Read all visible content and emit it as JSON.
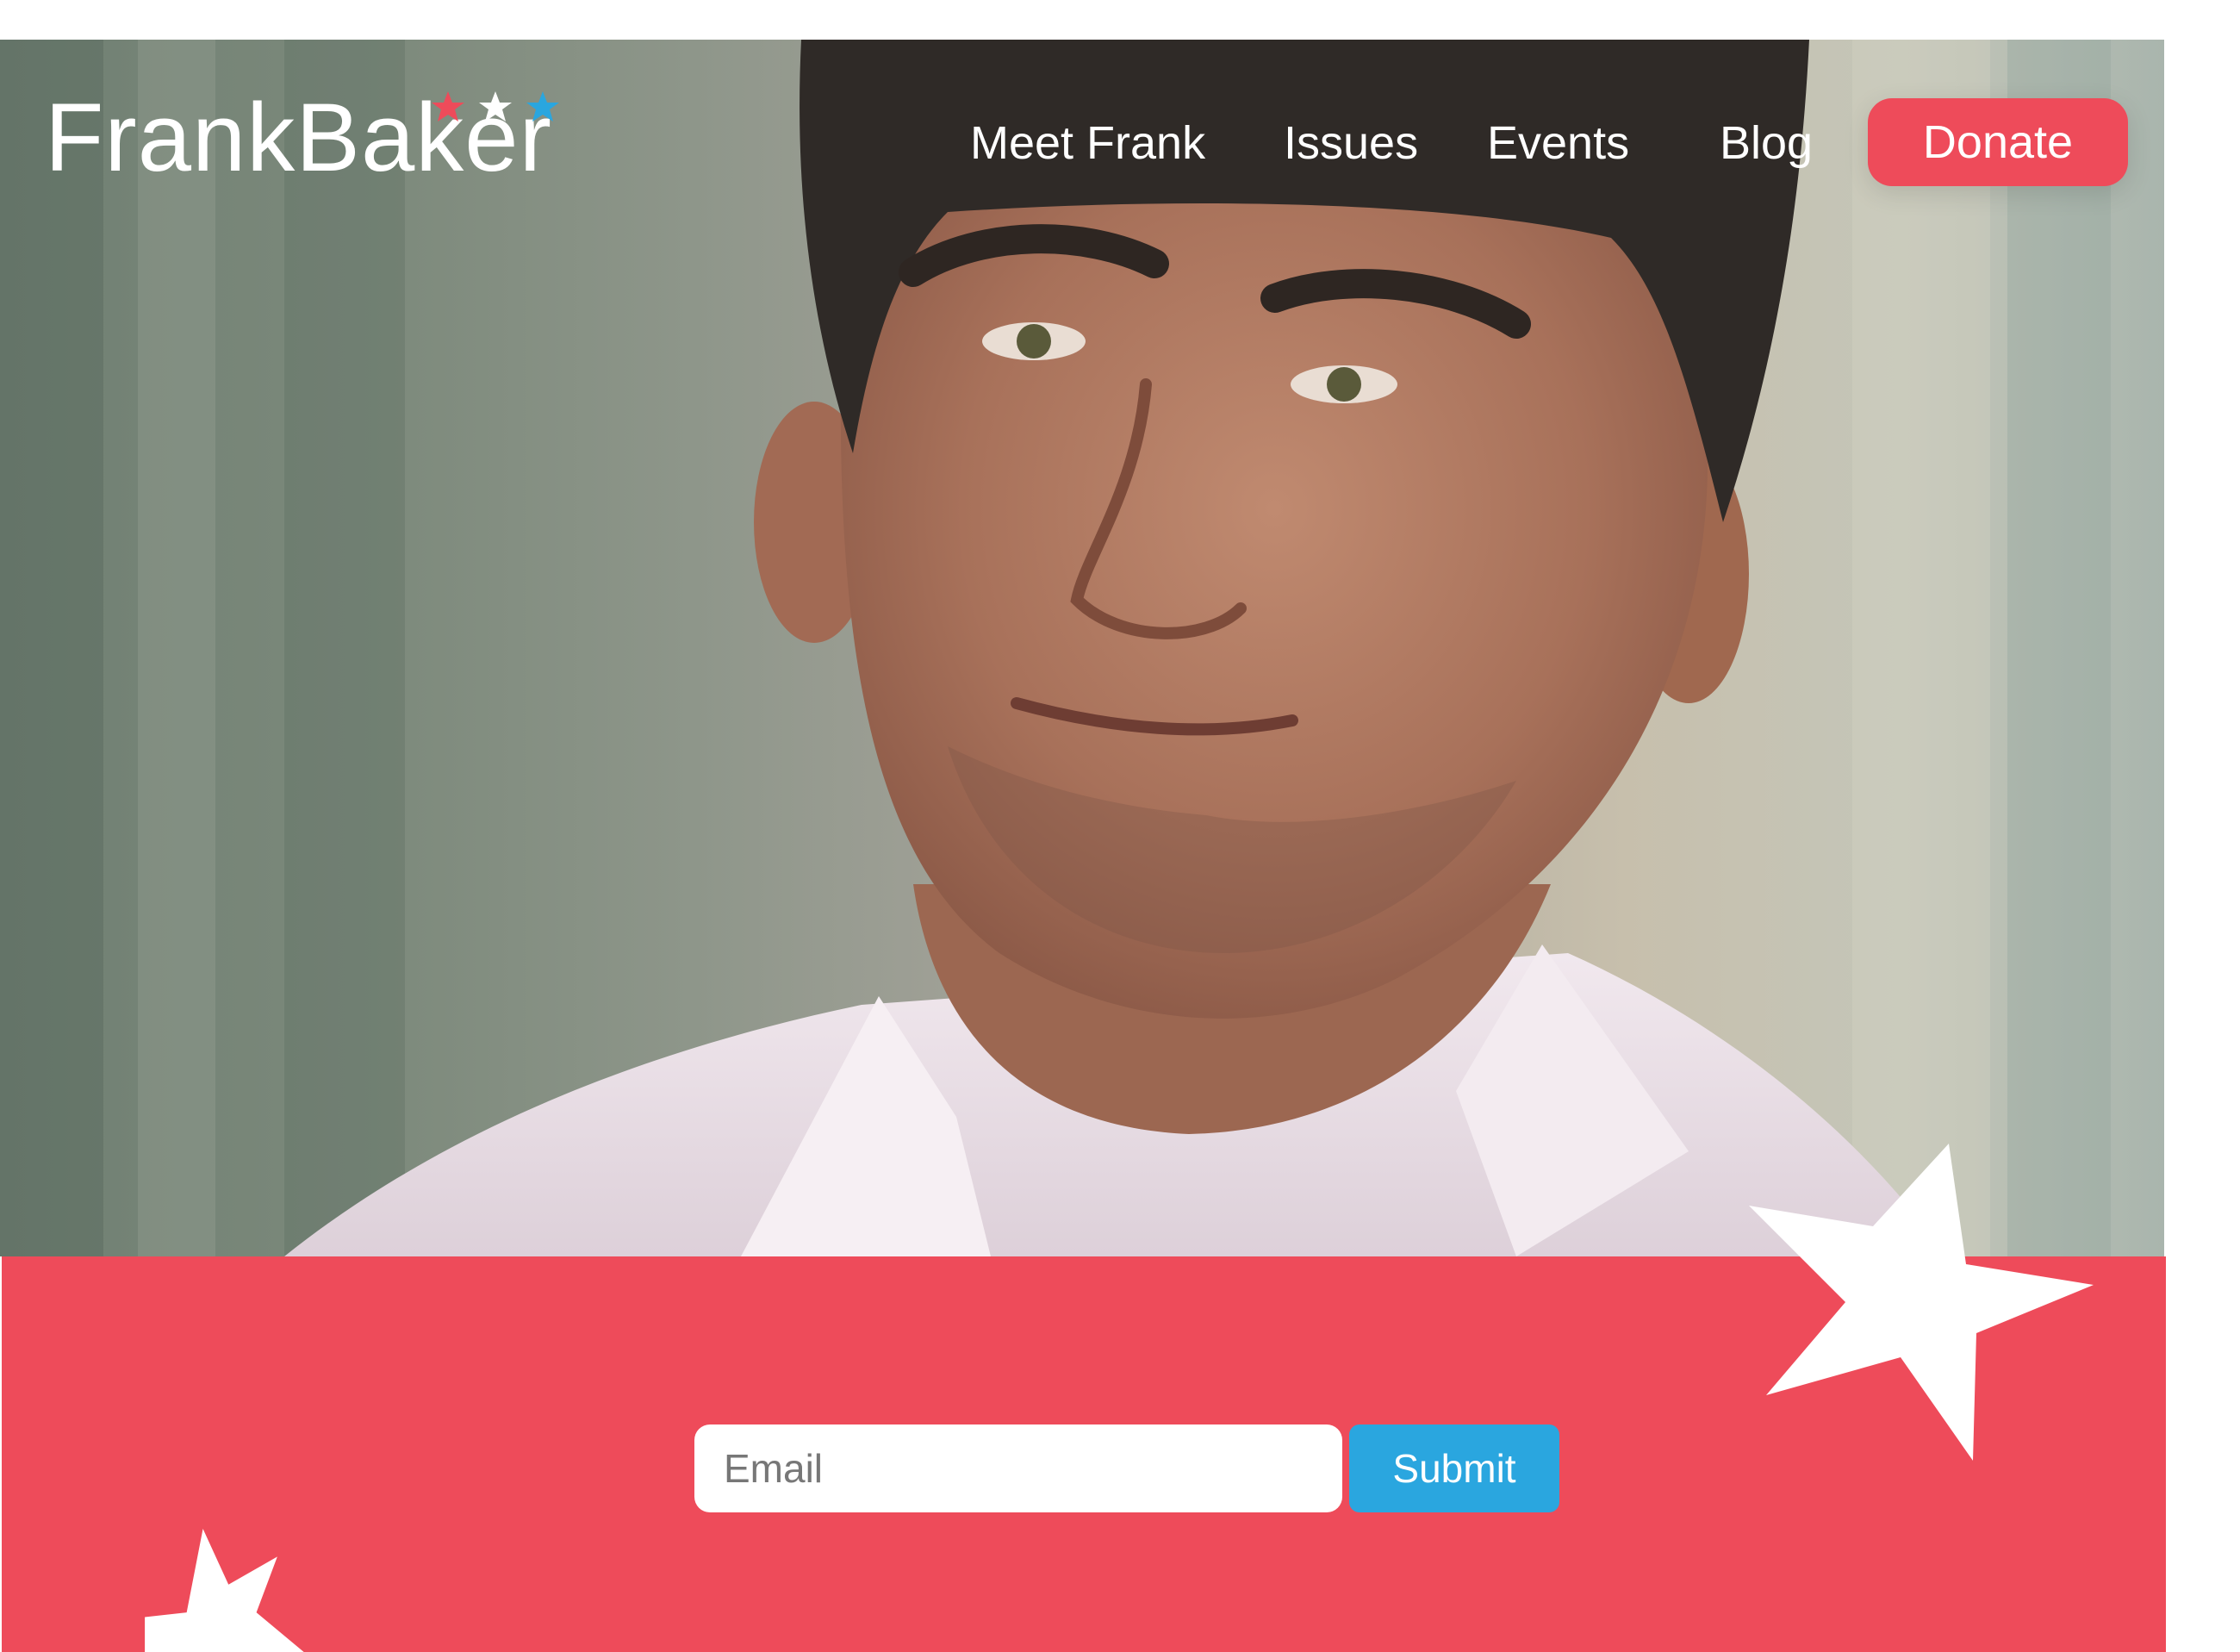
{
  "brand": {
    "logo_text": "FrankBaker",
    "logo_star_colors": [
      "#ee4b5a",
      "#ffffff",
      "#2aa6df"
    ]
  },
  "nav": {
    "items": [
      {
        "label": "Meet Frank"
      },
      {
        "label": "Issues"
      },
      {
        "label": "Events"
      },
      {
        "label": "Blog"
      }
    ],
    "donate_label": "Donate"
  },
  "signup": {
    "email_placeholder": "Email",
    "submit_label": "Submit"
  },
  "colors": {
    "accent_red": "#ee4b5a",
    "accent_blue": "#2aa6df"
  }
}
